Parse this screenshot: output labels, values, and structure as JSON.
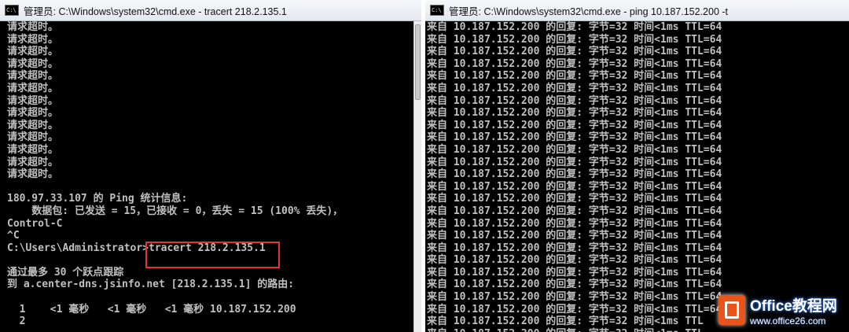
{
  "left_window": {
    "title": "管理员: C:\\Windows\\system32\\cmd.exe - tracert  218.2.135.1",
    "lines": [
      "请求超时。",
      "请求超时。",
      "请求超时。",
      "请求超时。",
      "请求超时。",
      "请求超时。",
      "请求超时。",
      "请求超时。",
      "请求超时。",
      "请求超时。",
      "请求超时。",
      "请求超时。",
      "请求超时。",
      "",
      "180.97.33.107 的 Ping 统计信息:",
      "    数据包: 已发送 = 15，已接收 = 0，丢失 = 15 (100% 丢失)，",
      "Control-C",
      "^C",
      "C:\\Users\\Administrator>tracert 218.2.135.1",
      "",
      "通过最多 30 个跃点跟踪",
      "到 a.center-dns.jsinfo.net [218.2.135.1] 的路由:",
      "",
      "  1    <1 毫秒   <1 毫秒   <1 毫秒 10.187.152.200",
      "  2"
    ]
  },
  "right_window": {
    "title": "管理员: C:\\Windows\\system32\\cmd.exe - ping  10.187.152.200 -t",
    "lines": [
      "来自 10.187.152.200 的回复: 字节=32 时间<1ms TTL=64",
      "来自 10.187.152.200 的回复: 字节=32 时间<1ms TTL=64",
      "来自 10.187.152.200 的回复: 字节=32 时间<1ms TTL=64",
      "来自 10.187.152.200 的回复: 字节=32 时间<1ms TTL=64",
      "来自 10.187.152.200 的回复: 字节=32 时间<1ms TTL=64",
      "来自 10.187.152.200 的回复: 字节=32 时间<1ms TTL=64",
      "来自 10.187.152.200 的回复: 字节=32 时间<1ms TTL=64",
      "来自 10.187.152.200 的回复: 字节=32 时间<1ms TTL=64",
      "来自 10.187.152.200 的回复: 字节=32 时间<1ms TTL=64",
      "来自 10.187.152.200 的回复: 字节=32 时间<1ms TTL=64",
      "来自 10.187.152.200 的回复: 字节=32 时间<1ms TTL=64",
      "来自 10.187.152.200 的回复: 字节=32 时间<1ms TTL=64",
      "来自 10.187.152.200 的回复: 字节=32 时间<1ms TTL=64",
      "来自 10.187.152.200 的回复: 字节=32 时间<1ms TTL=64",
      "来自 10.187.152.200 的回复: 字节=32 时间<1ms TTL=64",
      "来自 10.187.152.200 的回复: 字节=32 时间<1ms TTL=64",
      "来自 10.187.152.200 的回复: 字节=32 时间<1ms TTL=64",
      "来自 10.187.152.200 的回复: 字节=32 时间<1ms TTL=64",
      "来自 10.187.152.200 的回复: 字节=32 时间<1ms TTL=64",
      "来自 10.187.152.200 的回复: 字节=32 时间<1ms TTL=64",
      "来自 10.187.152.200 的回复: 字节=32 时间<1ms TTL=64",
      "来自 10.187.152.200 的回复: 字节=32 时间<1ms TTL=64",
      "来自 10.187.152.200 的回复: 字节=32 时间<1ms TTL=64",
      "来自 10.187.152.200 的回复: 字节=32 时间<1ms TTL=64",
      "来自 10.187.152.200 的回复: 字节=32 时间<1ms TTL",
      "来自 10.187.152.200 的回复: 字节=32 时间<1ms TTL"
    ]
  },
  "watermark": {
    "name": "Office教程网",
    "url": "www.office26.com"
  },
  "colors": {
    "console_bg": "#000000",
    "console_text": "#c0c0c0",
    "highlight": "#e53232",
    "watermark_logo": "#e8541c"
  }
}
